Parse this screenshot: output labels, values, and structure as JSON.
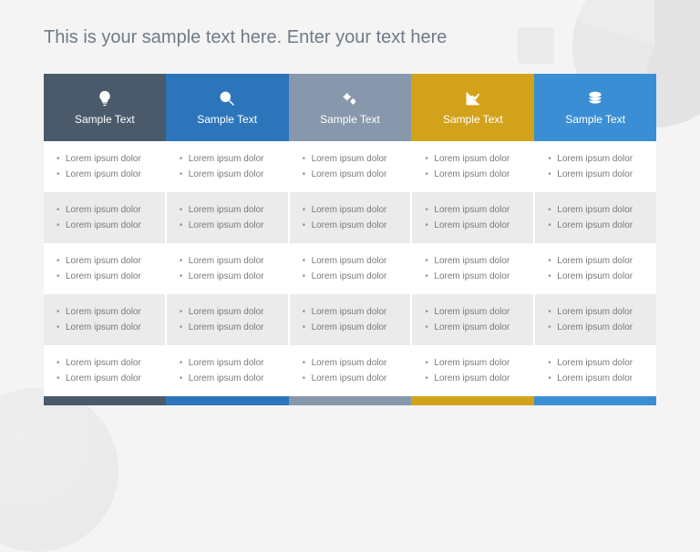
{
  "title": "This is your sample text here. Enter your text here",
  "colors": {
    "c0": "#4a5a6a",
    "c1": "#2d75bb",
    "c2": "#8798ad",
    "c3": "#d3a21b",
    "c4": "#3a8fd4"
  },
  "columns": [
    {
      "label": "Sample Text",
      "icon": "lightbulb-icon"
    },
    {
      "label": "Sample Text",
      "icon": "magnifier-icon"
    },
    {
      "label": "Sample Text",
      "icon": "gears-icon"
    },
    {
      "label": "Sample Text",
      "icon": "chart-icon"
    },
    {
      "label": "Sample Text",
      "icon": "layers-icon"
    }
  ],
  "rows": [
    [
      [
        "Lorem ipsum dolor",
        "Lorem ipsum dolor"
      ],
      [
        "Lorem ipsum dolor",
        "Lorem ipsum dolor"
      ],
      [
        "Lorem ipsum dolor",
        "Lorem ipsum dolor"
      ],
      [
        "Lorem ipsum dolor",
        "Lorem ipsum dolor"
      ],
      [
        "Lorem ipsum dolor",
        "Lorem ipsum dolor"
      ]
    ],
    [
      [
        "Lorem ipsum dolor",
        "Lorem ipsum dolor"
      ],
      [
        "Lorem ipsum dolor",
        "Lorem ipsum dolor"
      ],
      [
        "Lorem ipsum dolor",
        "Lorem ipsum dolor"
      ],
      [
        "Lorem ipsum dolor",
        "Lorem ipsum dolor"
      ],
      [
        "Lorem ipsum dolor",
        "Lorem ipsum dolor"
      ]
    ],
    [
      [
        "Lorem ipsum dolor",
        "Lorem ipsum dolor"
      ],
      [
        "Lorem ipsum dolor",
        "Lorem ipsum dolor"
      ],
      [
        "Lorem ipsum dolor",
        "Lorem ipsum dolor"
      ],
      [
        "Lorem ipsum dolor",
        "Lorem ipsum dolor"
      ],
      [
        "Lorem ipsum dolor",
        "Lorem ipsum dolor"
      ]
    ],
    [
      [
        "Lorem ipsum dolor",
        "Lorem ipsum dolor"
      ],
      [
        "Lorem ipsum dolor",
        "Lorem ipsum dolor"
      ],
      [
        "Lorem ipsum dolor",
        "Lorem ipsum dolor"
      ],
      [
        "Lorem ipsum dolor",
        "Lorem ipsum dolor"
      ],
      [
        "Lorem ipsum dolor",
        "Lorem ipsum dolor"
      ]
    ],
    [
      [
        "Lorem ipsum dolor",
        "Lorem ipsum dolor"
      ],
      [
        "Lorem ipsum dolor",
        "Lorem ipsum dolor"
      ],
      [
        "Lorem ipsum dolor",
        "Lorem ipsum dolor"
      ],
      [
        "Lorem ipsum dolor",
        "Lorem ipsum dolor"
      ],
      [
        "Lorem ipsum dolor",
        "Lorem ipsum dolor"
      ]
    ]
  ]
}
